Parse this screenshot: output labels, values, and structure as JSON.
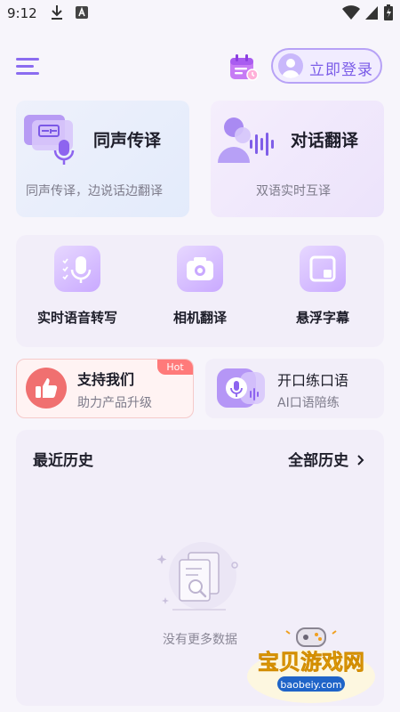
{
  "status_bar": {
    "time": "9:12"
  },
  "header": {
    "login_label": "立即登录"
  },
  "cards": {
    "simultaneous": {
      "title": "同声传译",
      "subtitle": "同声传译，边说话边翻译"
    },
    "dialogue": {
      "title": "对话翻译",
      "subtitle": "双语实时互译"
    }
  },
  "tools": [
    {
      "label": "实时语音转写"
    },
    {
      "label": "相机翻译"
    },
    {
      "label": "悬浮字幕"
    }
  ],
  "promo": {
    "support": {
      "title": "支持我们",
      "subtitle": "助力产品升级",
      "badge": "Hot"
    },
    "practice": {
      "title": "开口练口语",
      "subtitle": "AI口语陪练"
    }
  },
  "history": {
    "title": "最近历史",
    "all_label": "全部历史",
    "empty_text": "没有更多数据"
  },
  "watermark": {
    "brand": "宝贝游戏网",
    "url": "baobeiy.com"
  },
  "colors": {
    "accent": "#8b6cf0",
    "hot_badge": "#ff7a7a",
    "support_icon": "#f07070"
  }
}
